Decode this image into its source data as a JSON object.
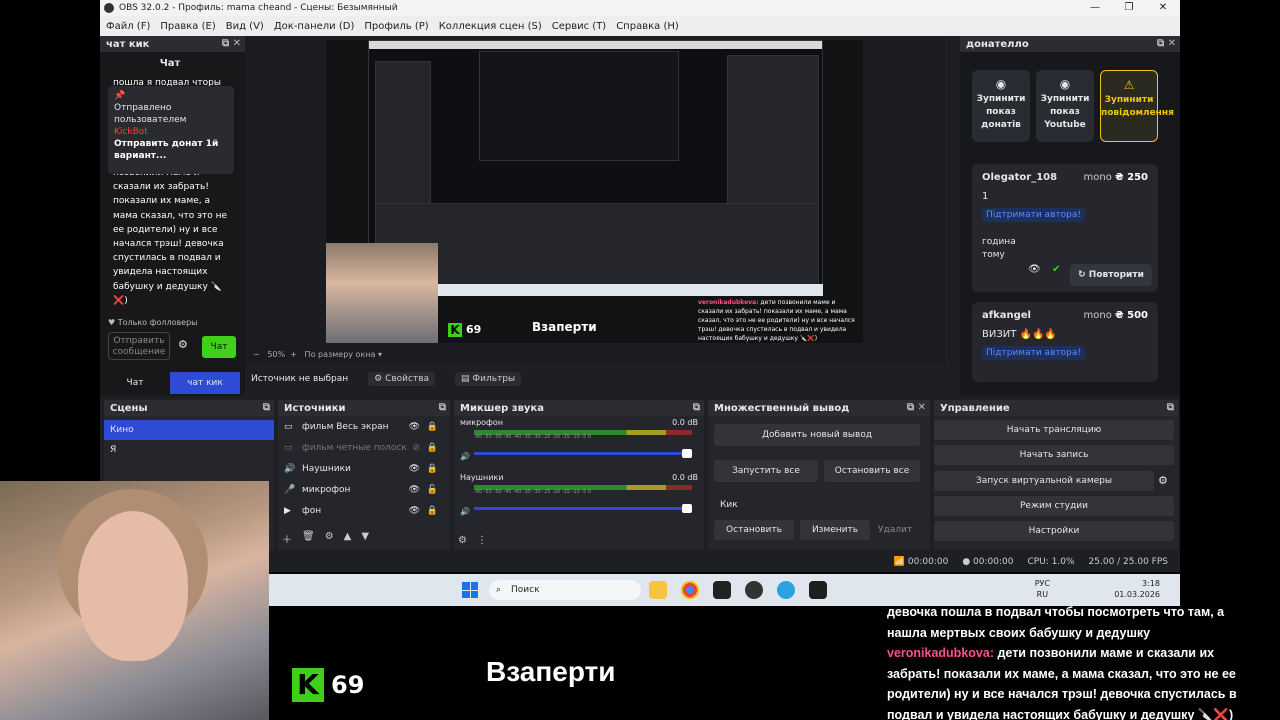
{
  "window": {
    "title": "OBS 32.0.2 - Профиль: mama cheand - Сцены: Безымянный",
    "controls": [
      "—",
      "❐",
      "✕"
    ]
  },
  "menu": [
    "Файл (F)",
    "Правка (E)",
    "Вид (V)",
    "Док-панели (D)",
    "Профиль (P)",
    "Коллекция сцен (S)",
    "Сервис (T)",
    "Справка (H)"
  ],
  "chat_dock": {
    "title": "чат кик",
    "header": "Чат",
    "top_partial": "пошла я подвал чторы",
    "pinned": {
      "status": "Отправлено пользователем",
      "user": "KickBot",
      "text": "Отправить донат 1й вариант..."
    },
    "message_lines": [
      "позвонили маме и",
      "сказали их забрать!",
      "показали их маме, а",
      "мама сказал, что это не",
      "ее родители) ну и все",
      "начался трэш! девочка",
      "спустилась в подвал и",
      "увидела настоящих",
      "бабушку и дедушку 🔪",
      "❌)"
    ],
    "followers_only": "Только фолловеры",
    "input_placeholder": "Отправить сообщение",
    "send_label": "Чат",
    "tabs": [
      "Чат",
      "чат кик"
    ]
  },
  "preview": {
    "zoom": "50%",
    "fit_label": "По размеру окна",
    "inner_count": "69",
    "inner_title": "Взаперти",
    "inner_chat_name": "veronikadubkova:",
    "inner_chat_text": "дети позвонили маме и сказали их забрать! показали их маме, а мама сказал, что это не ее родители) ну и все начался трэш! девочка спустилась в подвал и увидела настоящих бабушку и дедушку 🔪❌)"
  },
  "donate_dock": {
    "title": "донателло",
    "buttons": [
      {
        "label": "Зупинити показ донатів",
        "icon": "◉"
      },
      {
        "label": "Зупинити показ Youtube",
        "icon": "◉"
      },
      {
        "label": "Зупинити повідомлення",
        "icon": "⚠"
      }
    ],
    "donations": [
      {
        "name": "Olegator_108",
        "source": "mono",
        "amount": "₴ 250",
        "text": "1",
        "support": "Підтримати автора!",
        "time": "година тому",
        "repeat": "Повторити"
      },
      {
        "name": "afkangel",
        "source": "mono",
        "amount": "₴ 500",
        "text": "ВИЗИТ 🔥🔥🔥",
        "support": "Підтримати автора!"
      }
    ]
  },
  "source_bar": {
    "label": "Источник не выбран",
    "properties": "Свойства",
    "filters": "Фильтры"
  },
  "scenes": {
    "title": "Сцены",
    "items": [
      "Кино",
      "Я"
    ]
  },
  "sources": {
    "title": "Источники",
    "items": [
      {
        "name": "фильм Весь экран",
        "icon": "▭",
        "dim": false
      },
      {
        "name": "фильм четные полоск",
        "icon": "▭",
        "dim": true
      },
      {
        "name": "Наушники",
        "icon": "🔊",
        "dim": false
      },
      {
        "name": "микрофон",
        "icon": "🎤",
        "dim": false
      },
      {
        "name": "фон",
        "icon": "▶",
        "dim": false
      }
    ]
  },
  "mixer": {
    "title": "Микшер звука",
    "channels": [
      {
        "name": "микрофон",
        "db": "0.0 dB",
        "level": 0.85
      },
      {
        "name": "Наушники",
        "db": "0.0 dB",
        "level": 0.85
      }
    ],
    "ticks": "-60  -55  -50  -45  -40  -35  -30  -25  -20  -15  -10  -5  0"
  },
  "multi_output": {
    "title": "Множественный вывод",
    "add_target": "Добавить новый вывод",
    "start_all": "Запустить все",
    "stop_all": "Остановить все",
    "target_name": "Кик",
    "stop": "Остановить",
    "edit": "Изменить",
    "delete": "Удалит"
  },
  "controls": {
    "title": "Управление",
    "buttons": [
      "Начать трансляцию",
      "Начать запись",
      "Запуск виртуальной камеры",
      "Режим студии",
      "Настройки"
    ]
  },
  "status": {
    "stream_time": "00:00:00",
    "rec_time": "00:00:00",
    "cpu": "CPU: 1.0%",
    "fps": "25.00 / 25.00 FPS"
  },
  "taskbar": {
    "search": "Поиск",
    "lang": "РУС",
    "lang2": "RU",
    "time": "3:18",
    "date": "01.03.2026"
  },
  "overlay": {
    "count": "69",
    "title": "Взаперти",
    "chat_line1": "девочка пошла в подвал чтобы посмотреть что там, а",
    "chat_line2": "нашла мертвых своих бабушку и дедушку",
    "chat_name": "veronikadubkova:",
    "chat_text": "дети позвонили маме и сказали их забрать! показали их маме, а мама сказал, что это не ее родители) ну и все начался трэш! девочка спустилась в подвал и увидела настоящих бабушку и дедушку 🔪❌)"
  },
  "colors": {
    "accent": "#2e4bd6",
    "kick_green": "#3fd11a",
    "warn": "#f1c40f",
    "chat_name": "#ff4f8a"
  }
}
